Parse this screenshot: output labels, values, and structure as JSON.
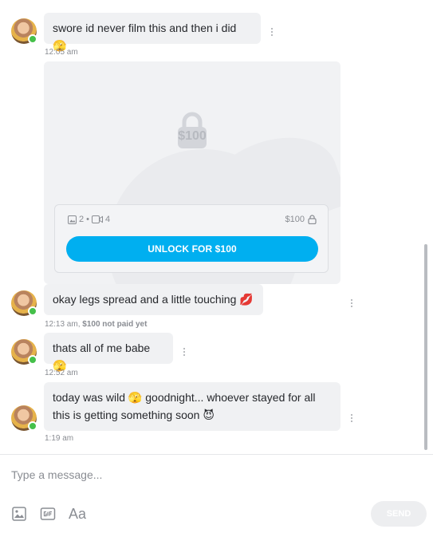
{
  "messages": [
    {
      "text": "swore id never film this and then i did 🫣",
      "time": "12:05 am"
    },
    {
      "locked": {
        "overlay_price": "$100",
        "photo_count": "2",
        "video_count": "4",
        "price": "$100",
        "unlock_label": "UNLOCK FOR $100"
      }
    },
    {
      "text": "okay legs spread and a little touching 💋",
      "time": "12:13 am,",
      "payment_status": "$100 not paid yet"
    },
    {
      "text": "thats all of me babe 🫣",
      "time": "12:52 am"
    },
    {
      "text": "today was wild 🫣 goodnight... whoever stayed for all this is getting something soon 😈",
      "time": "1:19 am"
    }
  ],
  "composer": {
    "placeholder": "Type a message...",
    "send_label": "SEND",
    "text_tool_label": "Aa"
  },
  "colors": {
    "accent": "#00aff0",
    "online": "#45c04a",
    "bubble": "#f0f1f3"
  }
}
